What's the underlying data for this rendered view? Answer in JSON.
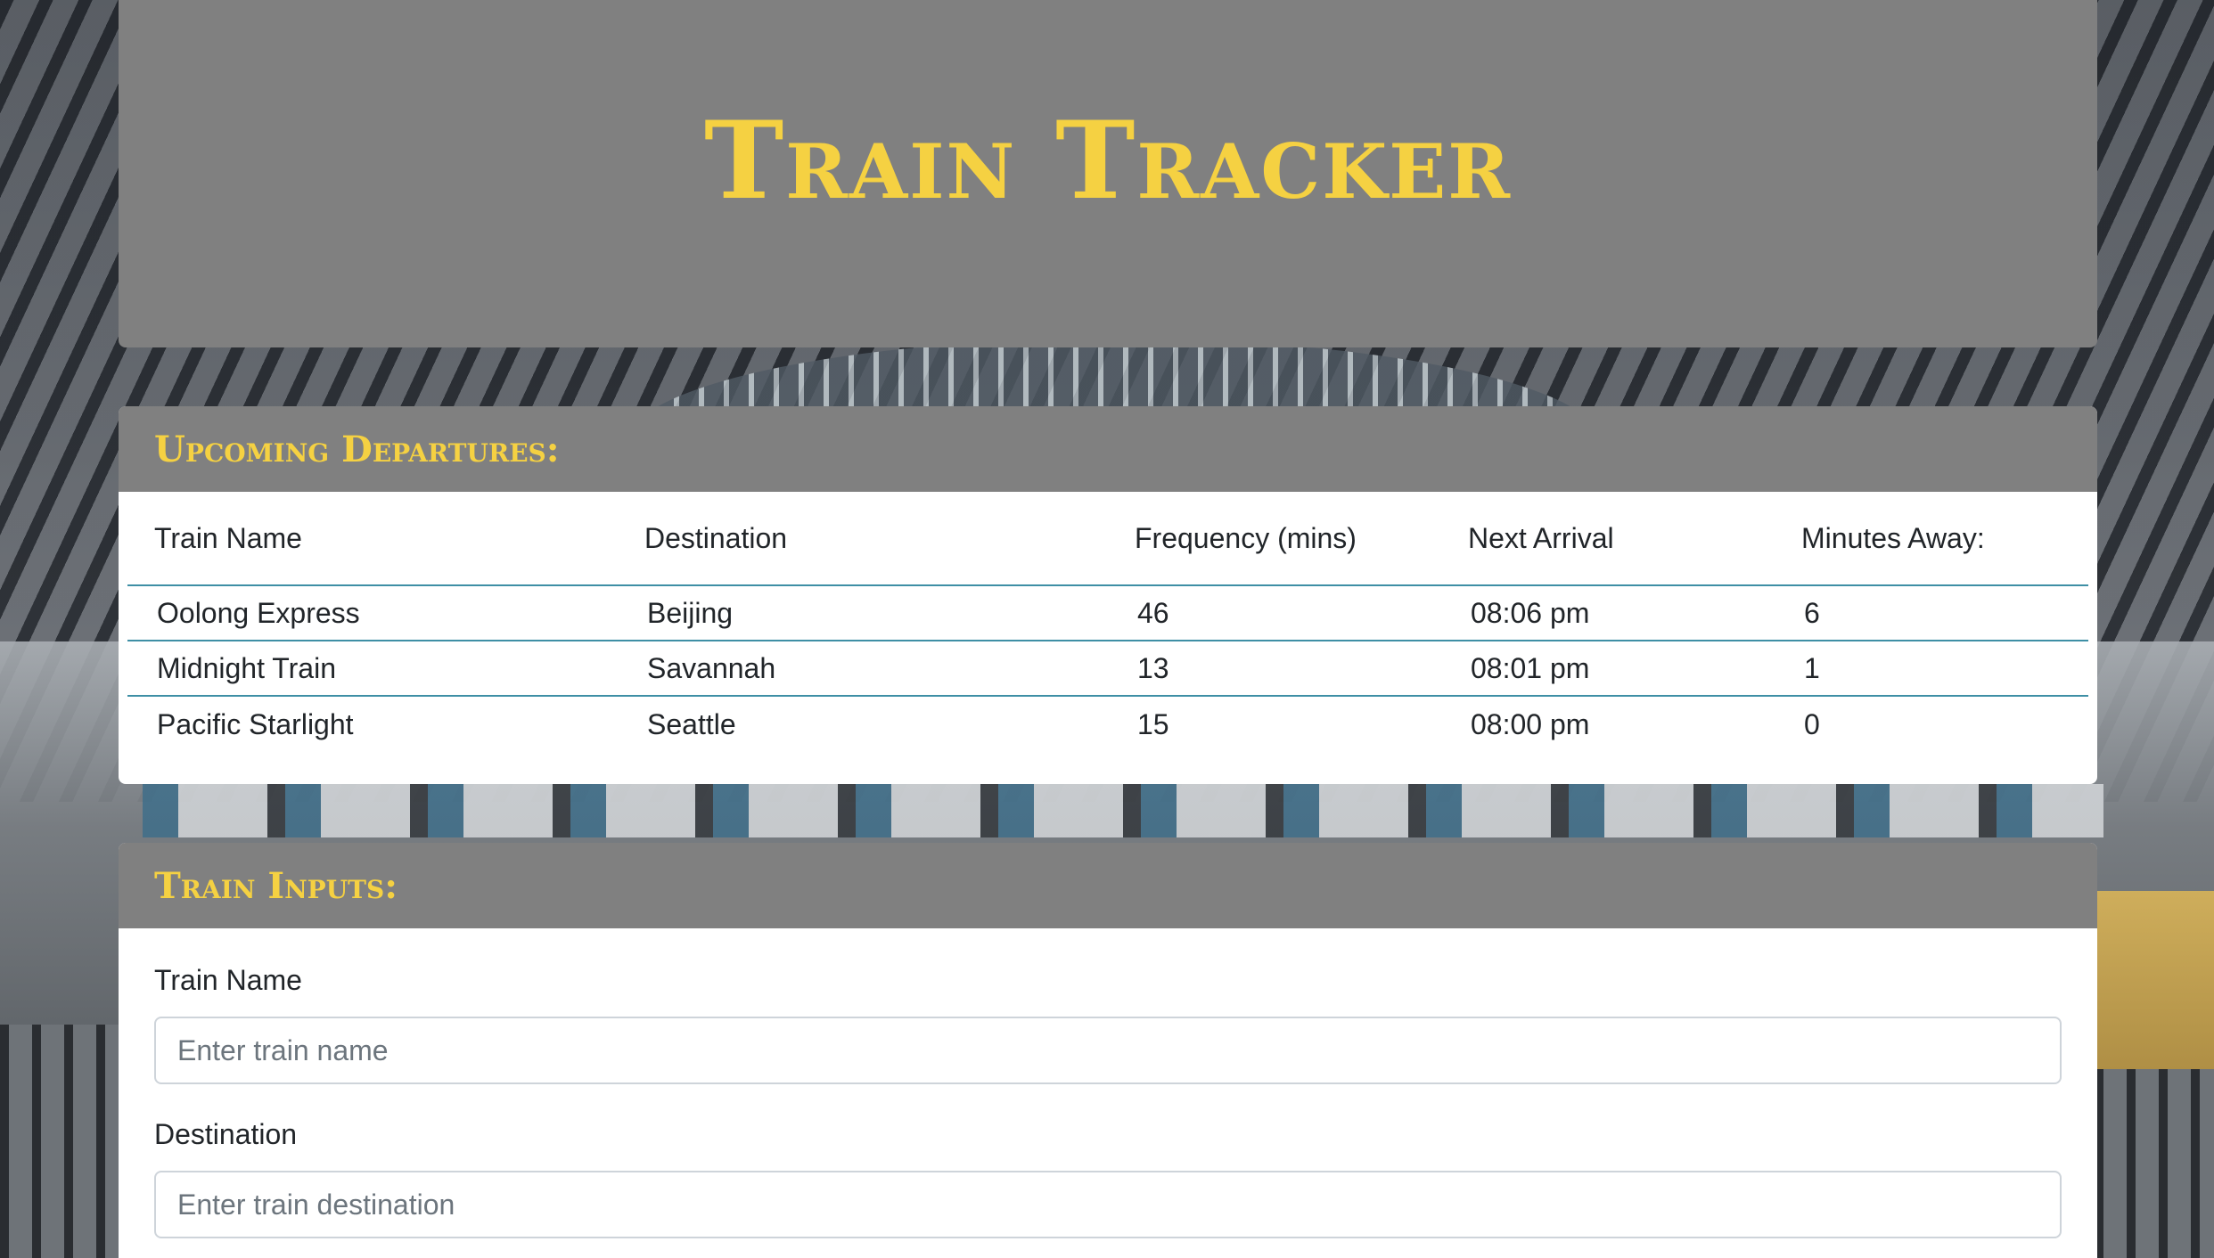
{
  "header": {
    "title": "Train Tracker"
  },
  "departures": {
    "title": "Upcoming Departures:",
    "columns": [
      "Train Name",
      "Destination",
      "Frequency (mins)",
      "Next Arrival",
      "Minutes Away:"
    ],
    "rows": [
      [
        "Oolong Express",
        "Beijing",
        "46",
        "08:06 pm",
        "6"
      ],
      [
        "Midnight Train",
        "Savannah",
        "13",
        "08:01 pm",
        "1"
      ],
      [
        "Pacific Starlight",
        "Seattle",
        "15",
        "08:00 pm",
        "0"
      ]
    ]
  },
  "inputs": {
    "title": "Train Inputs:",
    "fields": [
      {
        "label": "Train Name",
        "placeholder": "Enter train name",
        "value": ""
      },
      {
        "label": "Destination",
        "placeholder": "Enter train destination",
        "value": ""
      }
    ]
  },
  "colors": {
    "accent": "#f5d142",
    "header_bg": "#808080",
    "row_divider": "#3e8fa5"
  }
}
